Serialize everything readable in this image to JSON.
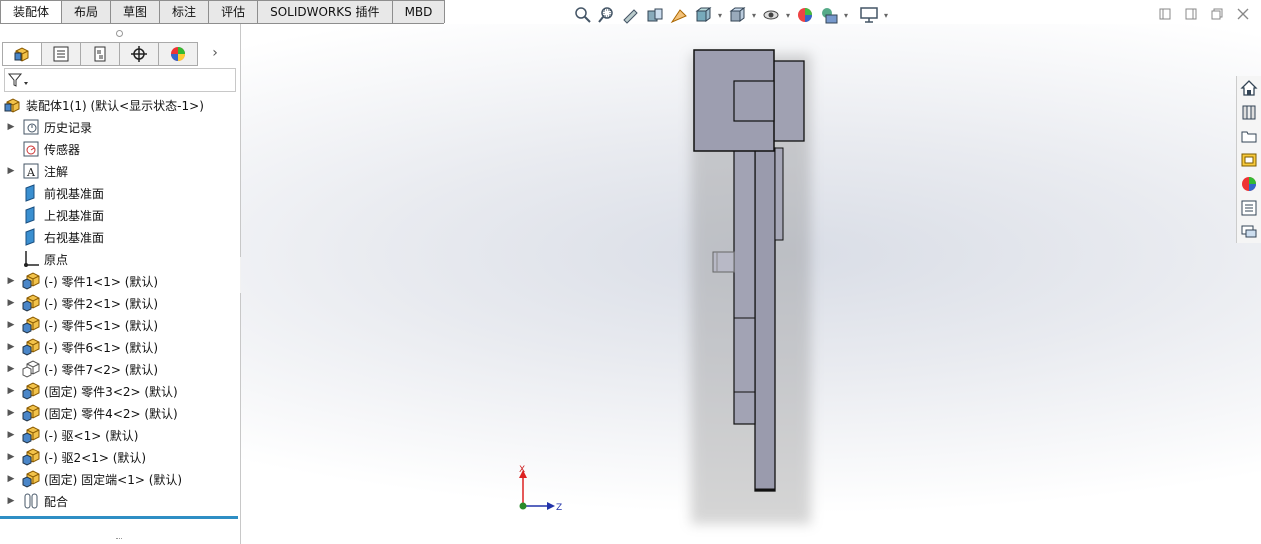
{
  "tabs": [
    "装配体",
    "布局",
    "草图",
    "标注",
    "评估",
    "SOLIDWORKS 插件",
    "MBD"
  ],
  "active_tab": 0,
  "heads_up_icons": [
    "zoom-to-fit-icon",
    "zoom-to-area-icon",
    "previous-view-icon",
    "section-view-icon",
    "dynamic-annotation-icon",
    "view-orientation-icon",
    "display-style-icon",
    "hide-show-items-icon",
    "edit-appearance-icon",
    "apply-scene-icon",
    "view-settings-icon"
  ],
  "window_controls": [
    "restore-left-icon",
    "restore-right-icon",
    "restore-icon",
    "close-icon"
  ],
  "feature_manager": {
    "tabs": [
      "featuremanager-tree-icon",
      "propertymanager-icon",
      "configurationmanager-icon",
      "dimxpertmanager-icon",
      "displaymanager-icon"
    ],
    "filter_icon": "filter-icon",
    "tree": [
      {
        "label": "装配体1(1)  (默认<显示状态-1>)",
        "icon": "assembly-icon",
        "expand": false,
        "root": true
      },
      {
        "label": "历史记录",
        "icon": "history-icon",
        "expand": true
      },
      {
        "label": "传感器",
        "icon": "sensor-icon",
        "expand": false
      },
      {
        "label": "注解",
        "icon": "annotation-icon",
        "expand": true
      },
      {
        "label": "前视基准面",
        "icon": "plane-icon",
        "expand": false
      },
      {
        "label": "上视基准面",
        "icon": "plane-icon",
        "expand": false
      },
      {
        "label": "右视基准面",
        "icon": "plane-icon",
        "expand": false
      },
      {
        "label": "原点",
        "icon": "origin-icon",
        "expand": false
      },
      {
        "label": "(-) 零件1<1> (默认)",
        "icon": "part-icon",
        "expand": true
      },
      {
        "label": "(-) 零件2<1> (默认)",
        "icon": "part-icon",
        "expand": true
      },
      {
        "label": "(-) 零件5<1> (默认)",
        "icon": "part-icon",
        "expand": true
      },
      {
        "label": "(-) 零件6<1> (默认)",
        "icon": "part-icon",
        "expand": true
      },
      {
        "label": "(-) 零件7<2> (默认)",
        "icon": "part-outline-icon",
        "expand": true
      },
      {
        "label": "(固定) 零件3<2> (默认)",
        "icon": "part-icon",
        "expand": true
      },
      {
        "label": "(固定) 零件4<2> (默认)",
        "icon": "part-icon",
        "expand": true
      },
      {
        "label": "(-) 驱<1> (默认)",
        "icon": "part-icon",
        "expand": true
      },
      {
        "label": "(-) 驱2<1> (默认)",
        "icon": "part-icon",
        "expand": true
      },
      {
        "label": "(固定) 固定端<1> (默认)",
        "icon": "part-icon",
        "expand": true
      },
      {
        "label": "配合",
        "icon": "mates-icon",
        "expand": true
      }
    ]
  },
  "task_pane_icons": [
    "solidworks-resources-icon",
    "design-library-icon",
    "file-explorer-icon",
    "view-palette-icon",
    "appearances-icon",
    "custom-properties-icon",
    "forum-icon"
  ],
  "triad": {
    "x_label": "X",
    "z_label": "Z"
  },
  "colors": {
    "part_face": "#9a9bad",
    "part_edge": "#111111",
    "accent_line": "#2e8ec4"
  }
}
